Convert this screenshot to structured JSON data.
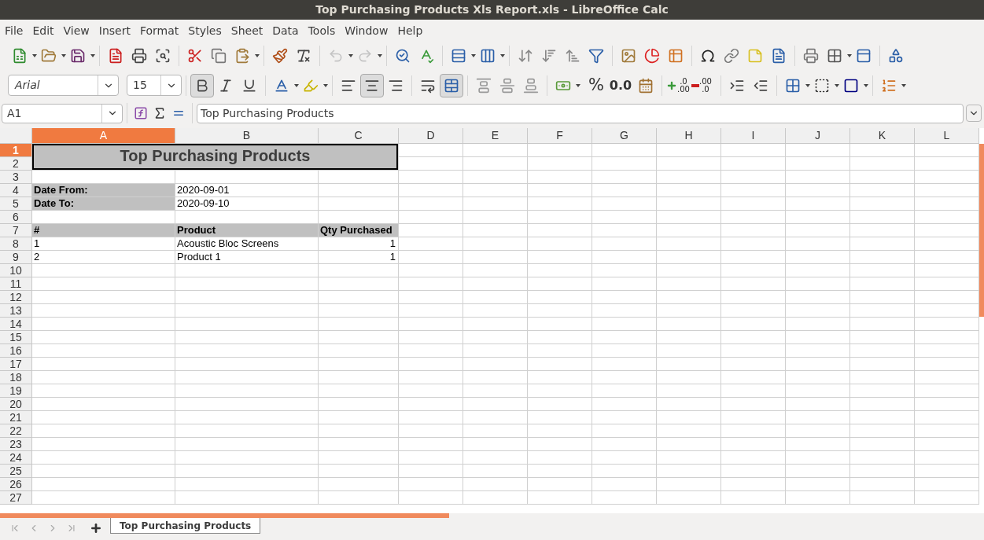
{
  "window": {
    "title": "Top Purchasing Products Xls Report.xls - LibreOffice Calc"
  },
  "menu": [
    "File",
    "Edit",
    "View",
    "Insert",
    "Format",
    "Styles",
    "Sheet",
    "Data",
    "Tools",
    "Window",
    "Help"
  ],
  "standard_toolbar": {
    "undo": {
      "disabled": true
    },
    "redo": {
      "disabled": true
    }
  },
  "format_toolbar": {
    "font": "Arial",
    "size": "15",
    "bold": true,
    "italic": false,
    "underline": false,
    "align_left": false,
    "align_center": true,
    "align_right": false,
    "wrap": false,
    "merge": true,
    "percent": "%",
    "number_format": "0.0",
    "add_decimal": [
      ".0",
      ".00"
    ],
    "delete_decimal": [
      ".00",
      ".0"
    ]
  },
  "formula_bar": {
    "name_box": "A1",
    "formula": "Top Purchasing Products"
  },
  "sheet": {
    "columns": [
      {
        "label": "A",
        "selected": true
      },
      {
        "label": "B",
        "selected": false
      },
      {
        "label": "C",
        "selected": false
      },
      {
        "label": "D",
        "selected": false
      },
      {
        "label": "E",
        "selected": false
      },
      {
        "label": "F",
        "selected": false
      },
      {
        "label": "G",
        "selected": false
      },
      {
        "label": "H",
        "selected": false
      },
      {
        "label": "I",
        "selected": false
      },
      {
        "label": "J",
        "selected": false
      },
      {
        "label": "K",
        "selected": false
      },
      {
        "label": "L",
        "selected": false
      }
    ],
    "rows": [
      {
        "label": "1",
        "selected": true,
        "cells": [
          {
            "kind": "title",
            "text": "Top Purchasing Products"
          }
        ]
      },
      {
        "label": "2",
        "selected": false
      },
      {
        "label": "3",
        "selected": false
      },
      {
        "label": "4",
        "selected": false,
        "cells": [
          {
            "kind": "label",
            "text": "Date From:"
          },
          {
            "kind": "value",
            "text": "2020-09-01"
          }
        ]
      },
      {
        "label": "5",
        "selected": false,
        "cells": [
          {
            "kind": "label",
            "text": "Date To:"
          },
          {
            "kind": "value",
            "text": "2020-09-10"
          }
        ]
      },
      {
        "label": "6",
        "selected": false
      },
      {
        "label": "7",
        "selected": false,
        "cells": [
          {
            "kind": "header",
            "text": "#"
          },
          {
            "kind": "header",
            "text": "Product"
          },
          {
            "kind": "header",
            "text": "Qty Purchased"
          }
        ]
      },
      {
        "label": "8",
        "selected": false,
        "cells": [
          {
            "kind": "value",
            "text": "1"
          },
          {
            "kind": "value",
            "text": "Acoustic Bloc Screens"
          },
          {
            "kind": "number",
            "text": "1"
          }
        ]
      },
      {
        "label": "9",
        "selected": false,
        "cells": [
          {
            "kind": "value",
            "text": "2"
          },
          {
            "kind": "value",
            "text": "Product 1"
          },
          {
            "kind": "number",
            "text": "1"
          }
        ]
      },
      {
        "label": "10",
        "selected": false
      },
      {
        "label": "11",
        "selected": false
      },
      {
        "label": "12",
        "selected": false
      },
      {
        "label": "13",
        "selected": false
      },
      {
        "label": "14",
        "selected": false
      },
      {
        "label": "15",
        "selected": false
      },
      {
        "label": "16",
        "selected": false
      },
      {
        "label": "17",
        "selected": false
      },
      {
        "label": "18",
        "selected": false
      },
      {
        "label": "19",
        "selected": false
      },
      {
        "label": "20",
        "selected": false
      },
      {
        "label": "21",
        "selected": false
      },
      {
        "label": "22",
        "selected": false
      },
      {
        "label": "23",
        "selected": false
      },
      {
        "label": "24",
        "selected": false
      },
      {
        "label": "25",
        "selected": false
      },
      {
        "label": "26",
        "selected": false
      },
      {
        "label": "27",
        "selected": false
      }
    ]
  },
  "sheet_tabs": [
    {
      "label": "Top Purchasing Products",
      "selected": true
    }
  ]
}
